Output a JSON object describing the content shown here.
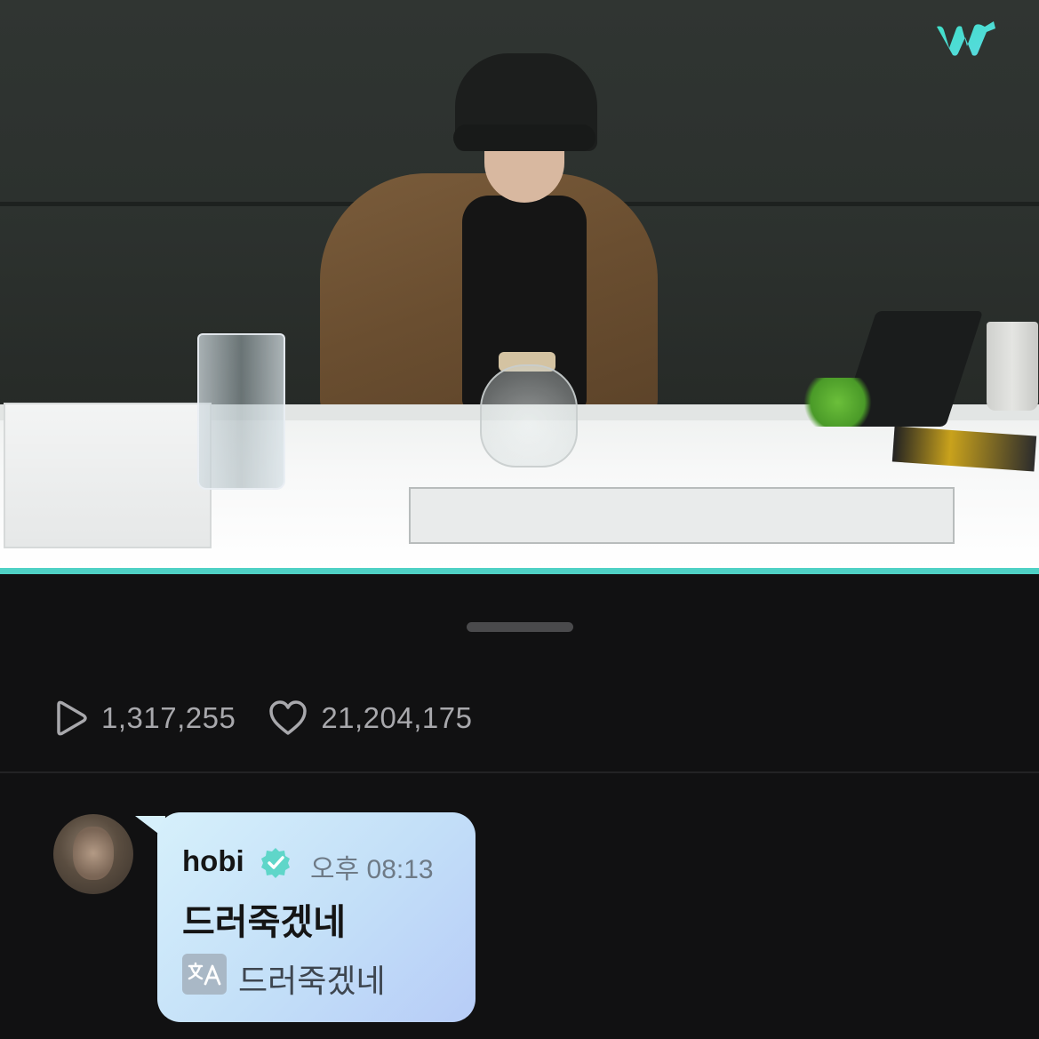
{
  "video": {
    "logo": "w",
    "accent_color": "#4fd1c5"
  },
  "stats": {
    "play_count": "1,317,255",
    "like_count": "21,204,175"
  },
  "comment": {
    "author": "hobi",
    "time": "오후 08:13",
    "text": "드러죽겠네",
    "translation": "드러죽겠네",
    "verified": true,
    "translate_icon": "translate-icon",
    "bubble_color": "#c9e6f9"
  }
}
